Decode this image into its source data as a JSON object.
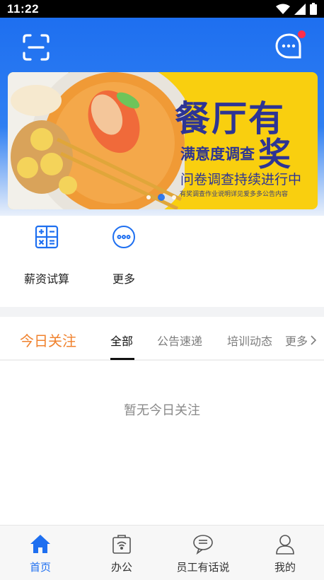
{
  "status_bar": {
    "time": "11:22"
  },
  "header": {
    "scan_icon": "scan-icon",
    "message_icon": "chat-bubble-icon",
    "has_unread": true
  },
  "banner": {
    "title": "餐厅有",
    "big_char": "奖",
    "subtitle": "满意度调查",
    "line": "问卷调查持续进行中",
    "small": "有奖调查作业说明详见爱多多公告内容",
    "dots": 3,
    "active_dot": 2
  },
  "quick_entries": [
    {
      "label": "薪资试算",
      "icon": "calculator-icon"
    },
    {
      "label": "更多",
      "icon": "more-dots-icon"
    }
  ],
  "tabs": {
    "today": "今日关注",
    "items": [
      "全部",
      "公告速递",
      "培训动态"
    ],
    "active_index": 0,
    "more": "更多"
  },
  "empty_message": "暂无今日关注",
  "bottom_nav": [
    {
      "label": "首页",
      "icon": "home-icon",
      "active": true
    },
    {
      "label": "办公",
      "icon": "office-bag-icon",
      "active": false
    },
    {
      "label": "员工有话说",
      "icon": "message-icon",
      "active": false
    },
    {
      "label": "我的",
      "icon": "user-icon",
      "active": false
    }
  ],
  "colors": {
    "primary": "#1e6ff0",
    "accent": "#f0822e",
    "banner_bg": "#f9cf0f",
    "banner_text": "#2d3494",
    "badge": "#ff2d4a"
  }
}
